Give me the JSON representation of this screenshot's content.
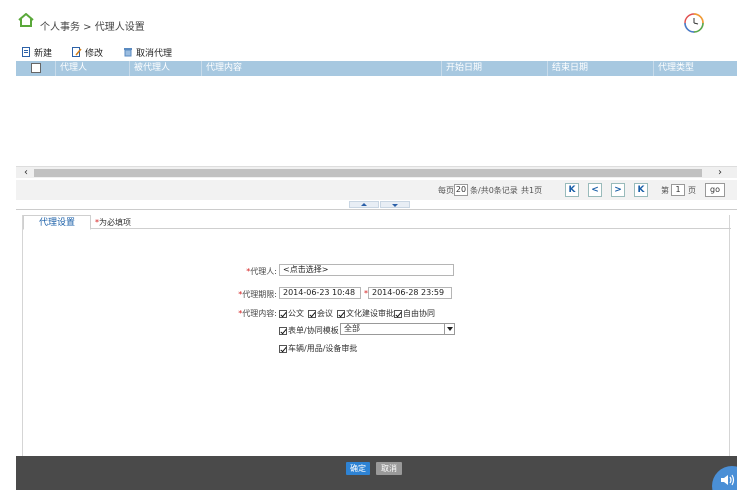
{
  "header": {
    "breadcrumb": "个人事务 > 代理人设置"
  },
  "toolbar": {
    "new_label": "新建",
    "edit_label": "修改",
    "cancel_proxy_label": "取消代理"
  },
  "grid": {
    "columns": [
      "代理人",
      "被代理人",
      "代理内容",
      "开始日期",
      "结束日期",
      "代理类型"
    ]
  },
  "pager": {
    "per_page_prefix": "每页",
    "per_page": "20",
    "summary": "条/共0条记录",
    "total_pages": "共1页",
    "page_prefix": "第",
    "current_page": "1",
    "page_suffix": "页",
    "go_label": "go",
    "first": "K",
    "prev": "<",
    "next": ">",
    "last": "K"
  },
  "form": {
    "tab_label": "代理设置",
    "required_note": "为必填项",
    "required_mark": "*",
    "proxy_label": "代理人:",
    "proxy_value": "<点击选择>",
    "period_label": "代理期限:",
    "start_value": "2014-06-23 10:48",
    "end_value": "2014-06-28 23:59",
    "content_label": "代理内容:",
    "options": {
      "doc": "公文",
      "meeting": "会议",
      "culture": "文化建设审批",
      "free": "自由协同",
      "form_template": "表单/协同模板",
      "vehicle": "车辆/用品/设备审批"
    },
    "form_template_select": "全部"
  },
  "footer": {
    "ok_label": "确定",
    "cancel_label": "取消"
  },
  "colors": {
    "grid_header": "#a7c8e0",
    "accent": "#2e83d4",
    "footer_bg": "#4a4a4a"
  }
}
